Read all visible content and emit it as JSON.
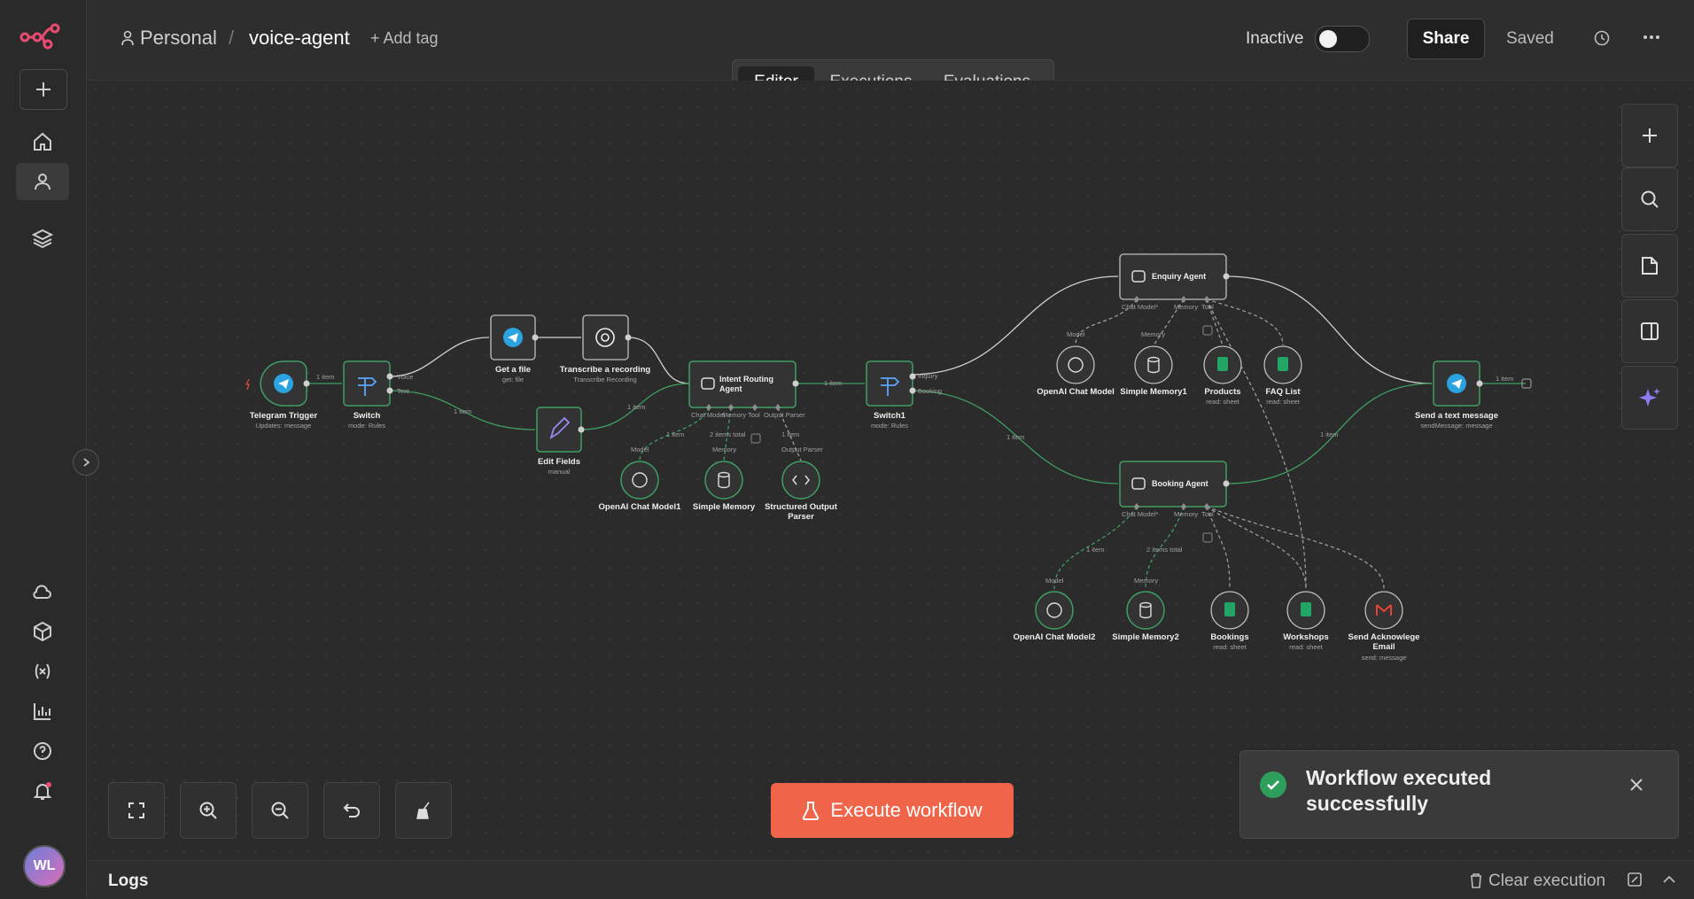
{
  "header": {
    "project": "Personal",
    "separator": "/",
    "workflow_name": "voice-agent",
    "add_tag": "+ Add tag",
    "status_label": "Inactive",
    "share": "Share",
    "saved": "Saved"
  },
  "tabs": [
    {
      "label": "Editor",
      "active": true
    },
    {
      "label": "Executions",
      "active": false
    },
    {
      "label": "Evaluations",
      "active": false
    }
  ],
  "sidebar": {
    "avatar_initials": "WL",
    "items": [
      "add-icon",
      "home-icon",
      "person-icon",
      "layers-icon",
      "cloud-icon",
      "box-icon",
      "variables-icon",
      "insights-icon",
      "help-icon",
      "bell-icon"
    ]
  },
  "nodes": {
    "telegram_trigger": {
      "label": "Telegram Trigger",
      "sub": "Updates: message"
    },
    "switch": {
      "label": "Switch",
      "sub": "mode: Rules"
    },
    "get_file": {
      "label": "Get a file",
      "sub": "get: file"
    },
    "transcribe": {
      "label": "Transcribe a recording",
      "sub": "Transcribe Recording"
    },
    "edit_fields": {
      "label": "Edit Fields",
      "sub": "manual"
    },
    "intent_agent": {
      "label": "Intent Routing Agent"
    },
    "openai1": {
      "label": "OpenAI Chat Model1"
    },
    "simple_memory": {
      "label": "Simple Memory"
    },
    "structured_parser": {
      "label": "Structured Output Parser"
    },
    "switch1": {
      "label": "Switch1",
      "sub": "mode: Rules"
    },
    "enquiry_agent": {
      "label": "Enquiry Agent"
    },
    "openai": {
      "label": "OpenAI Chat Model"
    },
    "simple_memory1": {
      "label": "Simple Memory1"
    },
    "products": {
      "label": "Products",
      "sub": "read: sheet"
    },
    "faq": {
      "label": "FAQ List",
      "sub": "read: sheet"
    },
    "booking_agent": {
      "label": "Booking Agent"
    },
    "openai2": {
      "label": "OpenAI Chat Model2"
    },
    "simple_memory2": {
      "label": "Simple Memory2"
    },
    "bookings": {
      "label": "Bookings",
      "sub": "read: sheet"
    },
    "workshops": {
      "label": "Workshops",
      "sub": "read: sheet"
    },
    "send_email": {
      "label": "Send Acknowlege Email",
      "sub": "send: message"
    },
    "send_text": {
      "label": "Send a text message",
      "sub": "sendMessage: message"
    }
  },
  "edge_labels": {
    "one_item": "1 item",
    "two_items": "2 items total",
    "voice": "Voice",
    "text": "Text",
    "inquiry": "Inquiry",
    "booking": "Booking"
  },
  "ports": {
    "chat_model": "Chat Model",
    "chat_model_req": "Chat Model*",
    "memory": "Memory",
    "tool": "Tool",
    "output_parser": "Output Parser",
    "model": "Model"
  },
  "execute_button": "Execute workflow",
  "toast": {
    "message": "Workflow executed successfully"
  },
  "logs": {
    "title": "Logs",
    "clear": "Clear execution"
  },
  "colors": {
    "accent": "#f0644a",
    "success": "#2e9e5b",
    "node_border_ok": "#3f9e63",
    "canvas": "#2b2b2b"
  }
}
